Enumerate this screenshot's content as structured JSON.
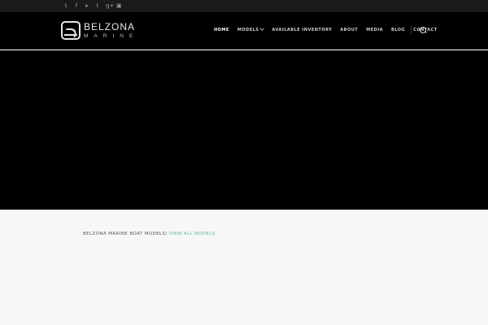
{
  "topbar": {
    "social_icons": [
      "twitter-icon",
      "facebook-icon",
      "youtube-icon",
      "tumblr-icon",
      "google-plus-icon",
      "instagram-icon"
    ],
    "social_glyphs": [
      "🐦",
      "f",
      "▶",
      "t",
      "g+",
      "◙"
    ]
  },
  "header": {
    "logo_name": "BELZONA",
    "logo_sub": "MARINE",
    "nav": {
      "home": "HOME",
      "models": "MODELS",
      "inventory": "AVAILABLE INVENTORY",
      "about": "ABOUT",
      "media": "MEDIA",
      "blog": "BLOG",
      "contact": "CONTACT"
    }
  },
  "content": {
    "crumb_text": "BELZONA MARINE BOAT MODELS",
    "crumb_sep": "/",
    "crumb_link": "VIEW ALL MODELS"
  },
  "colors": {
    "accent": "#5fb3a8",
    "header_bg": "#000000",
    "topbar_bg": "#1a1a1a",
    "page_bg": "#f7f7f7"
  }
}
